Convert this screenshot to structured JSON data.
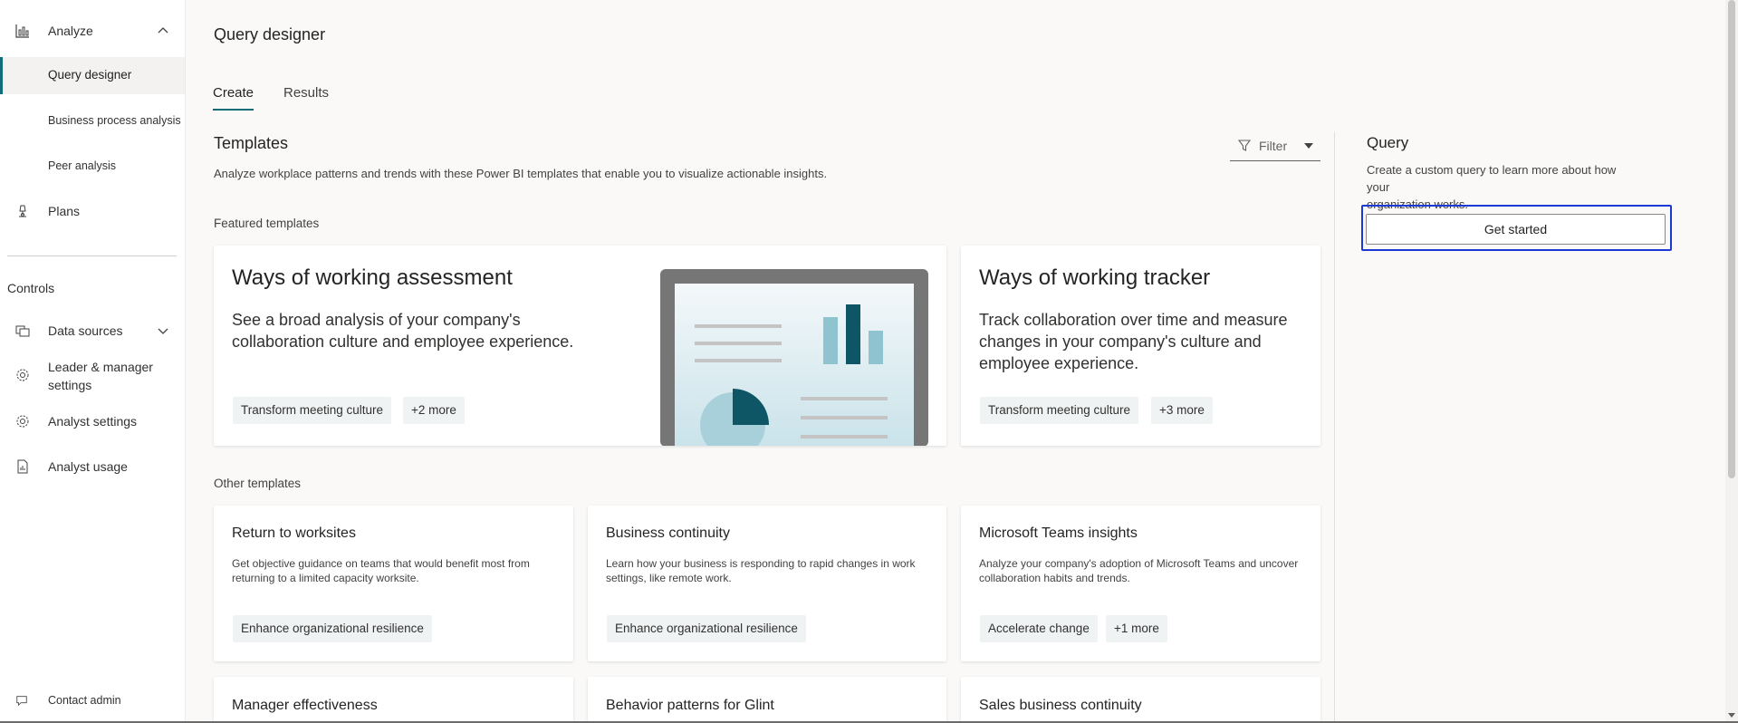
{
  "sidebar": {
    "analyze_label": "Analyze",
    "sub_items": [
      {
        "label": "Query designer"
      },
      {
        "label": "Business process analysis"
      },
      {
        "label": "Peer analysis"
      }
    ],
    "plans_label": "Plans",
    "controls_title": "Controls",
    "data_sources_label": "Data sources",
    "leader_settings_line1": "Leader & manager",
    "leader_settings_line2": "settings",
    "analyst_settings_label": "Analyst settings",
    "analyst_usage_label": "Analyst usage",
    "contact_admin_label": "Contact admin"
  },
  "header": {
    "title": "Query designer",
    "tabs": [
      {
        "label": "Create"
      },
      {
        "label": "Results"
      }
    ]
  },
  "templates": {
    "title": "Templates",
    "description": "Analyze workplace patterns and trends with these Power BI templates that enable you to visualize actionable insights.",
    "filter_label": "Filter",
    "featured_heading": "Featured templates",
    "other_heading": "Other templates",
    "featured": [
      {
        "title": "Ways of working assessment",
        "desc_line1": "See a broad analysis of your company's",
        "desc_line2": "collaboration culture and employee experience.",
        "chip": "Transform meeting culture",
        "more": "+2 more"
      },
      {
        "title": "Ways of working tracker",
        "desc_line1": "Track collaboration over time and measure",
        "desc_line2": "changes in your company's culture and",
        "desc_line3": "employee experience.",
        "chip": "Transform meeting culture",
        "more": "+3 more"
      }
    ],
    "other": [
      {
        "title": "Return to worksites",
        "desc_line1": "Get objective guidance on teams that would benefit most from",
        "desc_line2": "returning to a limited capacity worksite.",
        "chip": "Enhance organizational resilience"
      },
      {
        "title": "Business continuity",
        "desc_line1": "Learn how your business is responding to rapid changes in work",
        "desc_line2": "settings, like remote work.",
        "chip": "Enhance organizational resilience"
      },
      {
        "title": "Microsoft Teams insights",
        "desc_line1": "Analyze your company's adoption of Microsoft Teams and uncover",
        "desc_line2": "collaboration habits and trends.",
        "chip": "Accelerate change",
        "more": "+1 more"
      },
      {
        "title": "Manager effectiveness"
      },
      {
        "title": "Behavior patterns for Glint"
      },
      {
        "title": "Sales business continuity"
      }
    ]
  },
  "query": {
    "title": "Query",
    "desc_line1": "Create a custom query to learn more about how your",
    "desc_line2": "organization works.",
    "button_label": "Get started"
  },
  "colors": {
    "accent": "#0f6c78",
    "focus_ring": "#1d39d4",
    "chart_dark": "#0e5566",
    "chart_light": "#8fc3d0"
  },
  "icons": {
    "analyze": "bar-chart-icon",
    "plans": "lamp-icon",
    "data_sources": "database-icon",
    "leader_settings": "gear-icon",
    "analyst_settings": "gear-icon",
    "analyst_usage": "report-icon",
    "contact_admin": "chat-icon",
    "filter": "funnel-icon"
  }
}
